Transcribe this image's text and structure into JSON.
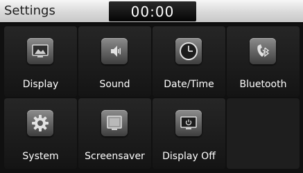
{
  "header": {
    "title": "Settings",
    "clock": "00:00"
  },
  "menu": {
    "items": [
      {
        "label": "Display",
        "icon": "display-icon"
      },
      {
        "label": "Sound",
        "icon": "speaker-icon"
      },
      {
        "label": "Date/Time",
        "icon": "clock-icon"
      },
      {
        "label": "Bluetooth",
        "icon": "bluetooth-phone-icon"
      },
      {
        "label": "System",
        "icon": "gear-icon"
      },
      {
        "label": "Screensaver",
        "icon": "screensaver-icon"
      },
      {
        "label": "Display Off",
        "icon": "display-off-icon"
      }
    ]
  }
}
